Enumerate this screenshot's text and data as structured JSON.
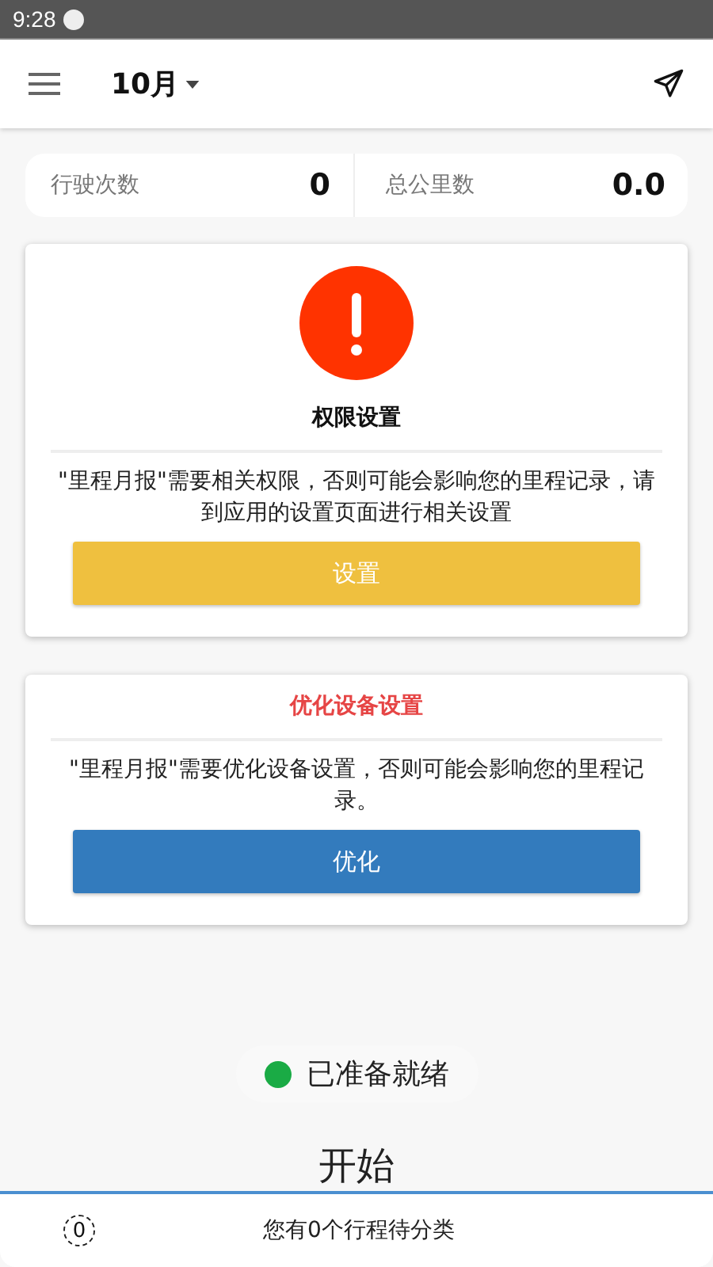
{
  "status_bar": {
    "time": "9:28"
  },
  "header": {
    "month": "10月"
  },
  "stats": [
    {
      "label": "行驶次数",
      "value": "0"
    },
    {
      "label": "总公里数",
      "value": "0.0"
    }
  ],
  "cards": [
    {
      "kind": "alert",
      "title": "权限设置",
      "message": "\"里程月报\"需要相关权限，否则可能会影响您的里程记录，请到应用的设置页面进行相关设置",
      "button": {
        "label": "设置",
        "color": "#efc03f"
      }
    },
    {
      "kind": "notice",
      "title": "优化设备设置",
      "message": "\"里程月报\"需要优化设备设置，否则可能会影响您的里程记录。",
      "button": {
        "label": "优化",
        "color": "#337bbd"
      }
    }
  ],
  "status": {
    "label": "已准备就绪",
    "color": "#1aab45"
  },
  "start": {
    "label": "开始"
  },
  "bottom_bar": {
    "count": "0",
    "message": "您有0个行程待分类"
  }
}
